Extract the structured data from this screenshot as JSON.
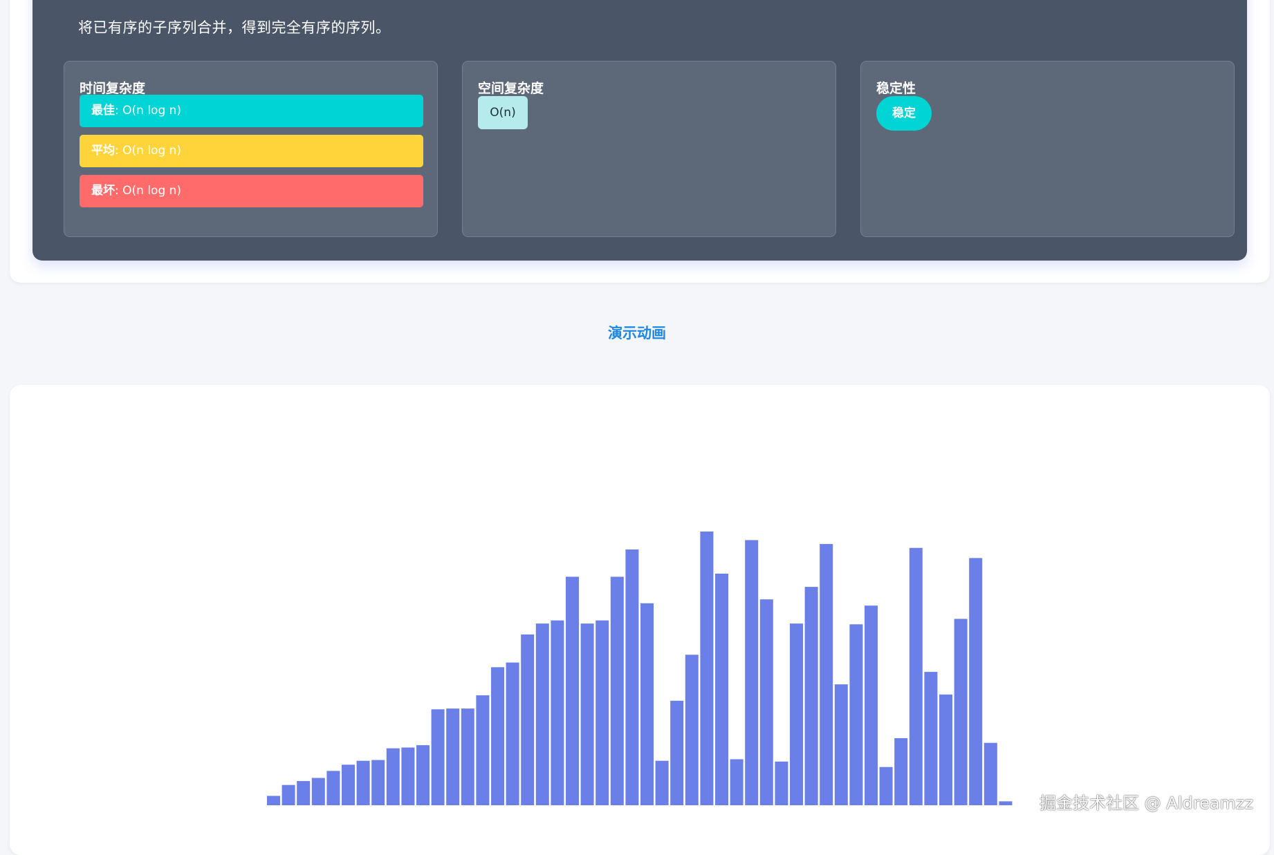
{
  "algorithm": {
    "description": "将已有序的子序列合并，得到完全有序的序列。",
    "time_complexity": {
      "title": "时间复杂度",
      "best": {
        "label": "最佳",
        "sep": ": ",
        "value": "O(n log n)"
      },
      "average": {
        "label": "平均",
        "sep": ": ",
        "value": "O(n log n)"
      },
      "worst": {
        "label": "最坏",
        "sep": ": ",
        "value": "O(n log n)"
      }
    },
    "space_complexity": {
      "title": "空间复杂度",
      "value": "O(n)"
    },
    "stability": {
      "title": "稳定性",
      "value": "稳定"
    }
  },
  "demo": {
    "label": "演示动画"
  },
  "colors": {
    "panel_bg": "#4a5568",
    "best": "#00d4d4",
    "average": "#ffd43b",
    "worst": "#ff6b6b",
    "bar": "#6b7fe8",
    "link": "#1e88e5"
  },
  "chart_data": {
    "type": "bar",
    "values": [
      12,
      26,
      31,
      35,
      44,
      52,
      57,
      58,
      73,
      74,
      77,
      123,
      124,
      124,
      141,
      177,
      183,
      219,
      233,
      237,
      293,
      233,
      237,
      293,
      328,
      259,
      57,
      134,
      193,
      351,
      297,
      59,
      340,
      264,
      56,
      233,
      280,
      335,
      155,
      232,
      256,
      49,
      86,
      330,
      171,
      142,
      239,
      317,
      80,
      5
    ],
    "ylim": [
      0,
      351
    ]
  },
  "watermark": "掘金技术社区 @ Aldreamzz"
}
